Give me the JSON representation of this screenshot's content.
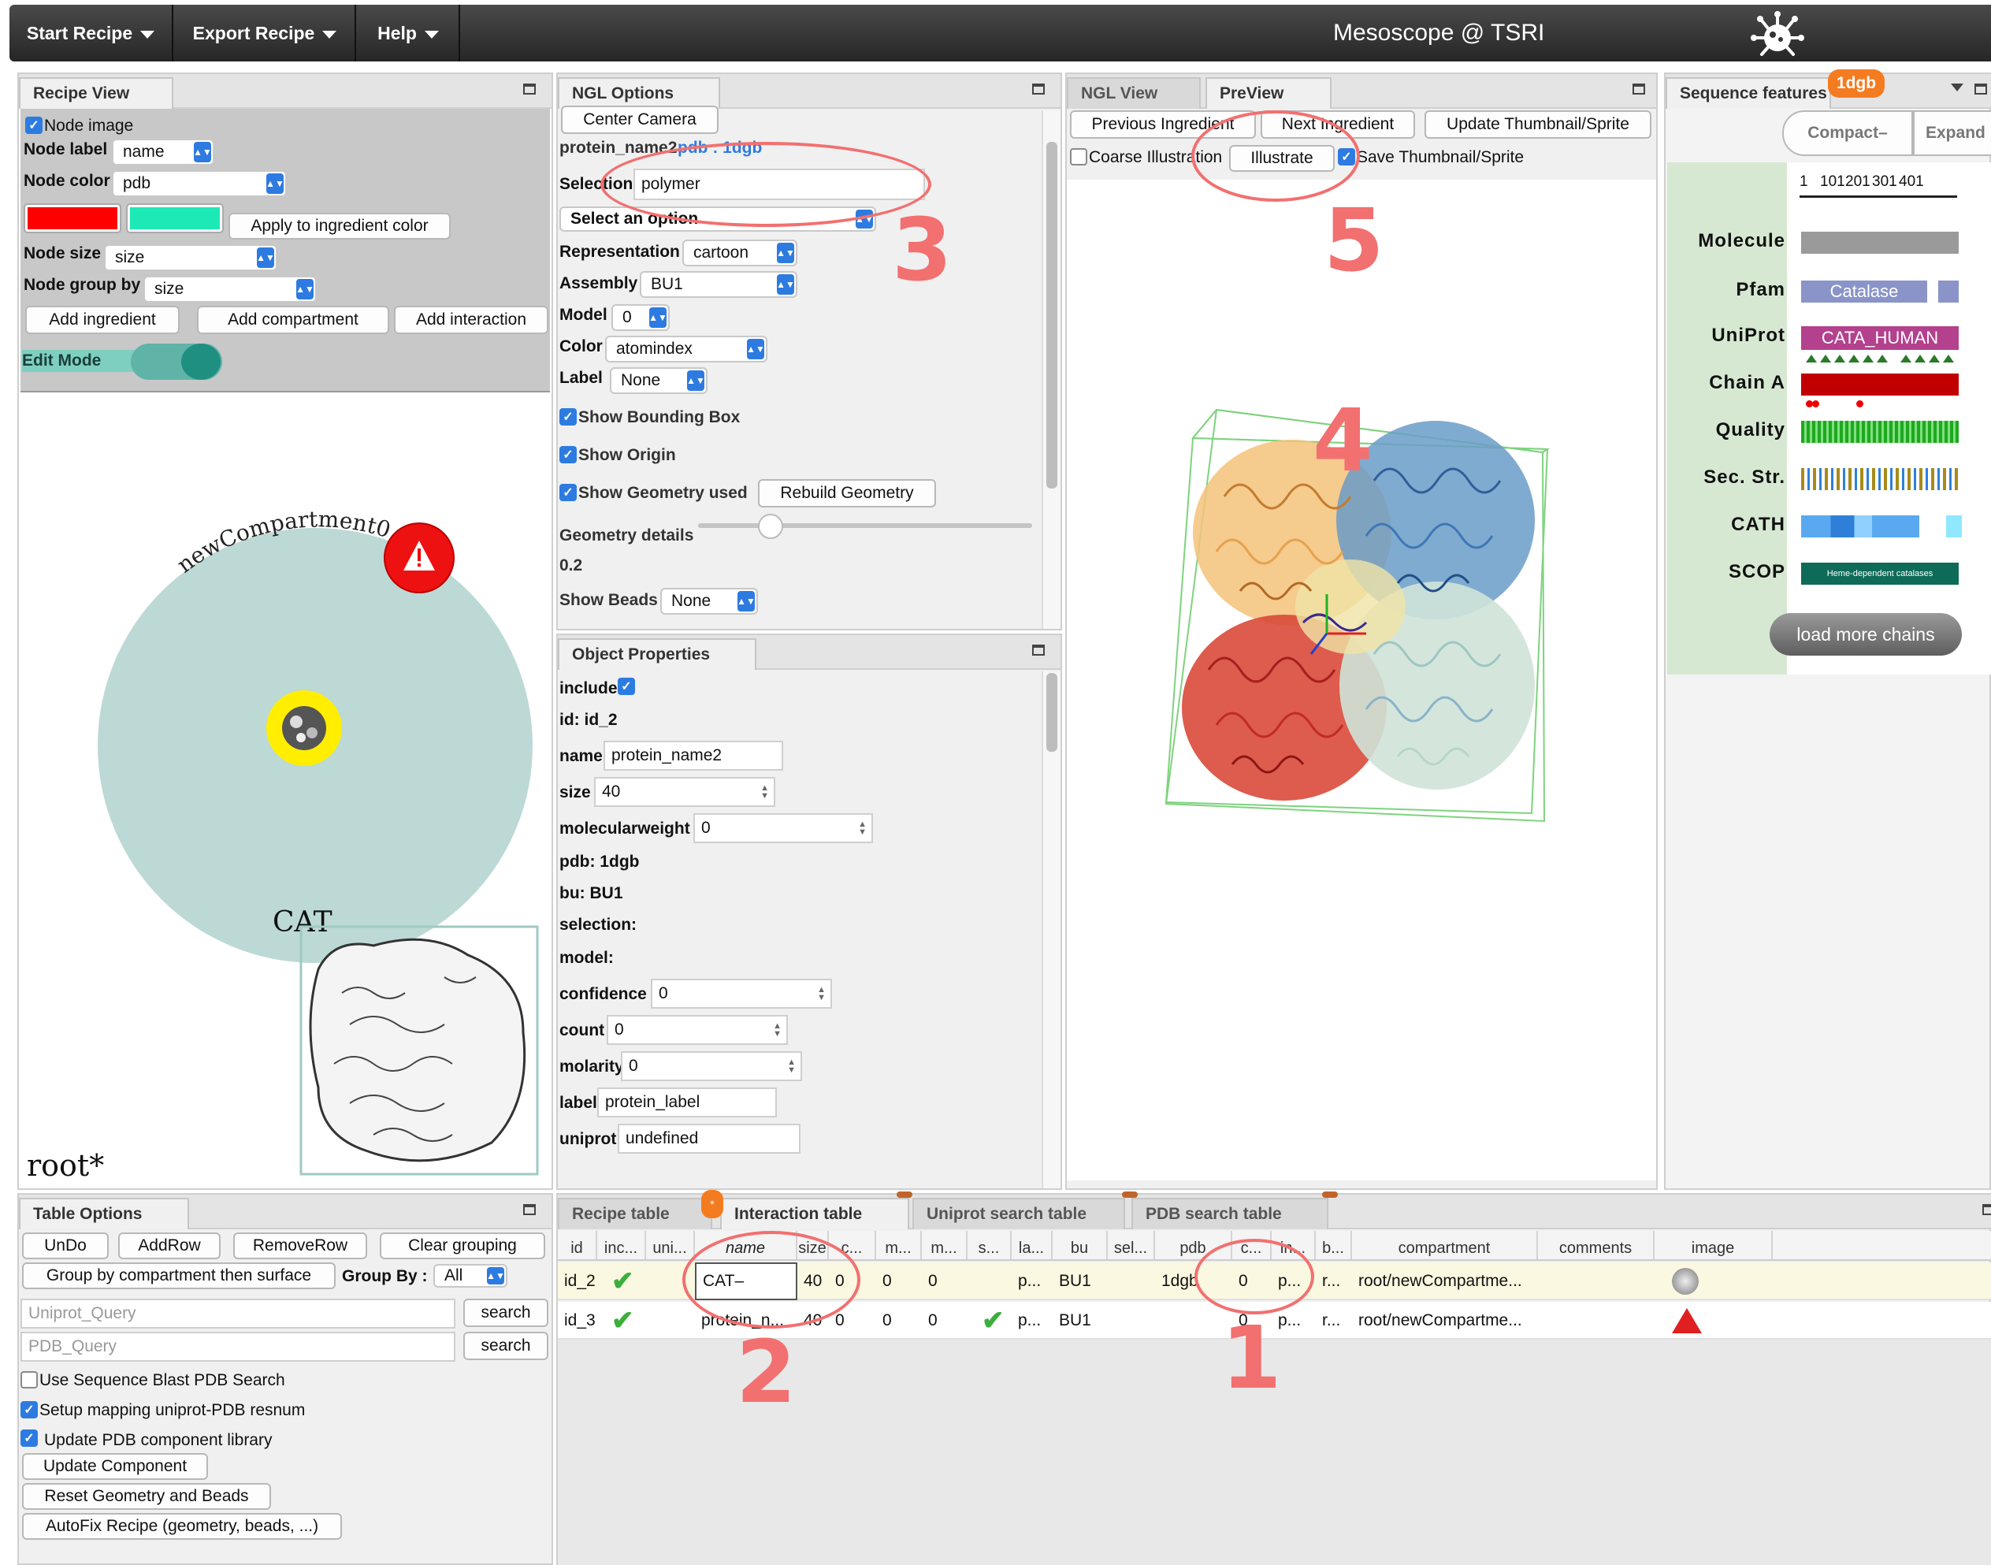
{
  "menu": {
    "start_recipe": "Start Recipe",
    "export_recipe": "Export Recipe",
    "help": "Help",
    "title": "Mesoscope @ TSRI"
  },
  "recipe_view": {
    "tab": "Recipe View",
    "node_image": "Node image",
    "node_label_label": "Node label",
    "node_label_value": "name",
    "node_color_label": "Node color",
    "node_color_value": "pdb",
    "color1": "#ff0000",
    "color2": "#1de9b6",
    "apply_color": "Apply to ingredient color",
    "node_size_label": "Node size",
    "node_size_value": "size",
    "node_group_label": "Node group by",
    "node_group_value": "size",
    "add_ingredient": "Add ingredient",
    "add_compartment": "Add compartment",
    "add_interaction": "Add interaction",
    "edit_mode": "Edit Mode",
    "compartment_name": "newCompartment0",
    "ingredient_label": "CAT",
    "root_label": "root*"
  },
  "ngl_options": {
    "tab": "NGL Options",
    "center_camera": "Center Camera",
    "protein_name": "protein_name2",
    "pdb_link": "pdb : 1dgb",
    "selection_label": "Selection",
    "selection_value": "polymer",
    "select_option": "Select an option",
    "representation_label": "Representation",
    "representation_value": "cartoon",
    "assembly_label": "Assembly",
    "assembly_value": "BU1",
    "model_label": "Model",
    "model_value": "0",
    "color_label": "Color",
    "color_value": "atomindex",
    "label_label": "Label",
    "label_value": "None",
    "show_bbox": "Show Bounding Box",
    "show_origin": "Show Origin",
    "show_geometry": "Show Geometry used",
    "rebuild_geometry": "Rebuild Geometry",
    "geometry_details": "Geometry details",
    "geometry_value": "0.2",
    "show_beads": "Show Beads",
    "beads_value": "None"
  },
  "object_props": {
    "tab": "Object Properties",
    "include": "include",
    "id": "id: id_2",
    "name_label": "name",
    "name_value": "protein_name2",
    "size_label": "size",
    "size_value": "40",
    "mw_label": "molecularweight",
    "mw_value": "0",
    "pdb": "pdb: 1dgb",
    "bu": "bu: BU1",
    "selection": "selection:",
    "model": "model:",
    "confidence_label": "confidence",
    "confidence_value": "0",
    "count_label": "count",
    "count_value": "0",
    "molarity_label": "molarity",
    "molarity_value": "0",
    "label_label": "label",
    "label_value": "protein_label",
    "uniprot_label": "uniprot",
    "uniprot_value": "undefined"
  },
  "ngl_view": {
    "tab_ngl": "NGL View",
    "tab_preview": "PreView",
    "prev_ingredient": "Previous Ingredient",
    "next_ingredient": "Next Ingredient",
    "update_thumbnail": "Update Thumbnail/Sprite",
    "coarse_illustration": "Coarse Illustration",
    "illustrate": "Illustrate",
    "save_thumbnail": "Save Thumbnail/Sprite"
  },
  "sequence": {
    "tab": "Sequence features",
    "badge": "1dgb",
    "compact": "Compact–",
    "expand": "Expand",
    "ticks": [
      "1",
      "101",
      "201",
      "301",
      "401"
    ],
    "rows": [
      "Molecule",
      "Pfam",
      "UniProt",
      "Chain A",
      "Quality",
      "Sec. Str.",
      "CATH",
      "SCOP"
    ],
    "pfam_text": "Catalase",
    "uniprot_text": "CATA_HUMAN",
    "scop_text": "Heme-dependent catalases",
    "load_more": "load more chains"
  },
  "table_options": {
    "tab": "Table Options",
    "undo": "UnDo",
    "add_row": "AddRow",
    "remove_row": "RemoveRow",
    "clear_grouping": "Clear grouping",
    "group_compartment": "Group by compartment then surface",
    "group_by_label": "Group By :",
    "group_by_value": "All",
    "uniprot_query": "Uniprot_Query",
    "pdb_query": "PDB_Query",
    "search": "search",
    "use_blast": "Use Sequence Blast PDB Search",
    "setup_mapping": "Setup mapping uniprot-PDB resnum",
    "update_library": "Update PDB component library",
    "update_component": "Update Component",
    "reset_geometry": "Reset Geometry and Beads",
    "autofix": "AutoFix Recipe (geometry, beads, ...)"
  },
  "recipe_table": {
    "tabs": [
      "Recipe table",
      "Interaction table",
      "Uniprot search table",
      "PDB search table"
    ],
    "columns": [
      "id",
      "inc...",
      "uni...",
      "name",
      "size",
      "c...",
      "m...",
      "m...",
      "s...",
      "la...",
      "bu",
      "sel...",
      "pdb",
      "c...",
      "in...",
      "b...",
      "compartment",
      "comments",
      "image"
    ],
    "rows": [
      {
        "id": "id_2",
        "name": "CAT–",
        "size": "40",
        "c": "0",
        "m1": "0",
        "m2": "0",
        "la": "p...",
        "bu": "BU1",
        "pdb": "1dgb",
        "c2": "0",
        "in": "p...",
        "b": "r...",
        "compartment": "root/newCompartme..."
      },
      {
        "id": "id_3",
        "name": "protein_n...",
        "size": "40",
        "c": "0",
        "m1": "0",
        "m2": "0",
        "la": "p...",
        "bu": "BU1",
        "pdb": "",
        "c2": "0",
        "in": "p...",
        "b": "r...",
        "compartment": "root/newCompartme..."
      }
    ]
  },
  "annotations": [
    "1",
    "2",
    "3",
    "4",
    "5"
  ]
}
